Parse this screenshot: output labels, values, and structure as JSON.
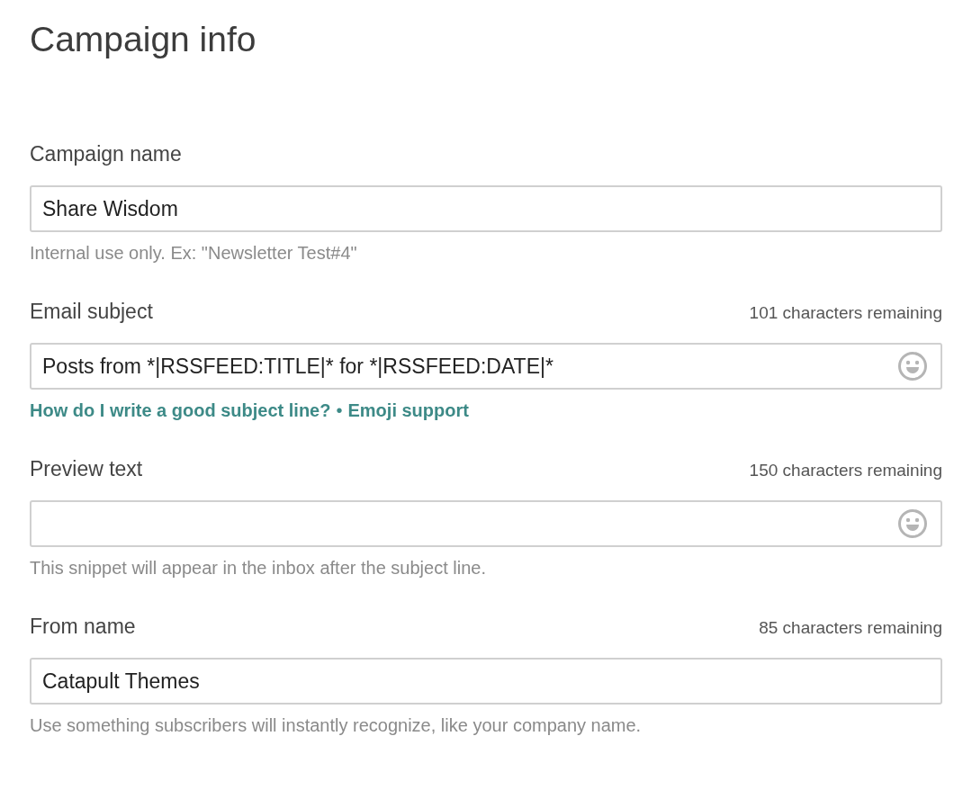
{
  "title": "Campaign info",
  "fields": [
    {
      "label": "Campaign name",
      "value": "Share Wisdom",
      "emoji": false,
      "help": [
        {
          "kind": "text",
          "text": "Internal use only. Ex: \"Newsletter Test#4\""
        }
      ]
    },
    {
      "label": "Email subject",
      "counter": "101 characters remaining",
      "value": "Posts from *|RSSFEED:TITLE|* for *|RSSFEED:DATE|*",
      "emoji": true,
      "help": [
        {
          "kind": "link",
          "text": "How do I write a good subject line?"
        },
        {
          "kind": "sep",
          "text": "•"
        },
        {
          "kind": "link",
          "text": "Emoji support"
        }
      ]
    },
    {
      "label": "Preview text",
      "counter": "150 characters remaining",
      "emoji": true,
      "help": [
        {
          "kind": "text",
          "text": "This snippet will appear in the inbox after the subject line."
        }
      ]
    },
    {
      "label": "From name",
      "counter": "85 characters remaining",
      "value": "Catapult Themes",
      "emoji": false,
      "help": [
        {
          "kind": "text",
          "text": "Use something subscribers will instantly recognize, like your company name."
        }
      ]
    }
  ]
}
